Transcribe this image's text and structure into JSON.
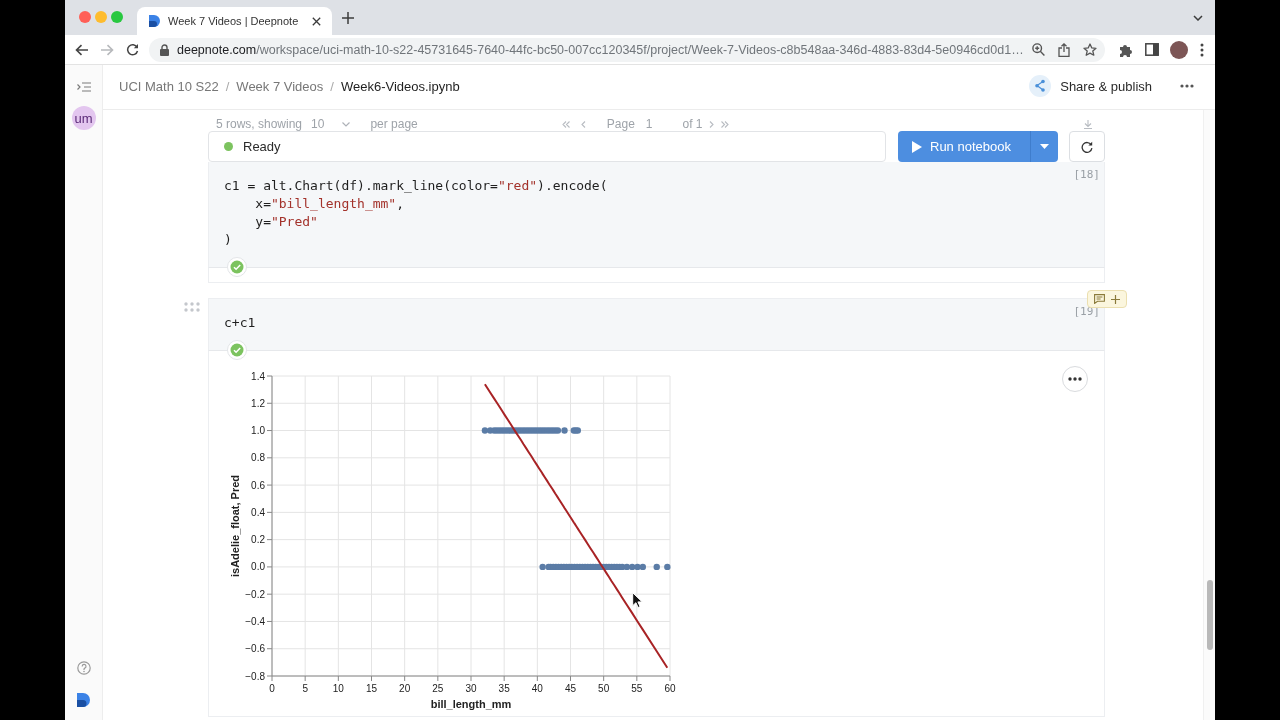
{
  "browser": {
    "tab": {
      "title": "Week 7 Videos | Deepnote"
    },
    "url": {
      "host": "deepnote.com",
      "path": "/workspace/uci-math-10-s22-45731645-7640-44fc-bc50-007cc120345f/project/Week-7-Videos-c8b548aa-346d-4883-83d4-5e0946cd0d1…"
    }
  },
  "sidebar": {
    "avatar": "um"
  },
  "header": {
    "breadcrumbs": [
      {
        "label": "UCI Math 10 S22",
        "current": false
      },
      {
        "label": "Week 7 Videos",
        "current": false
      },
      {
        "label": "Week6-Videos.ipynb",
        "current": true
      }
    ],
    "separator": "/",
    "share_label": "Share & publish"
  },
  "pager": {
    "rows_label": "5 rows, showing",
    "page_size": "10",
    "per_page": "per page",
    "page_label": "Page",
    "page": "1",
    "of_label": "of 1"
  },
  "run_bar": {
    "status": "Ready",
    "run_label": "Run notebook"
  },
  "cells": [
    {
      "count": "[18]",
      "done": true,
      "code": [
        [
          {
            "kind": "plain",
            "text": "c1 = alt.Chart(df).mark_line(color="
          },
          {
            "kind": "string",
            "text": "\"red\""
          },
          {
            "kind": "plain",
            "text": ").encode("
          }
        ],
        [
          {
            "kind": "plain",
            "text": "    x="
          },
          {
            "kind": "string",
            "text": "\"bill_length_mm\""
          },
          {
            "kind": "plain",
            "text": ","
          }
        ],
        [
          {
            "kind": "plain",
            "text": "    y="
          },
          {
            "kind": "string",
            "text": "\"Pred\""
          }
        ],
        [
          {
            "kind": "plain",
            "text": ")"
          }
        ]
      ]
    },
    {
      "count": "[19]",
      "done": true,
      "code": [
        [
          {
            "kind": "plain",
            "text": "c+c1"
          }
        ]
      ],
      "chart_data": {
        "type": "scatter",
        "xlabel": "bill_length_mm",
        "ylabel": "isAdelie_float, Pred",
        "grid": true,
        "xlim": [
          0,
          60
        ],
        "ylim": [
          -0.8,
          1.4
        ],
        "xticks": [
          0,
          5,
          10,
          15,
          20,
          25,
          30,
          35,
          40,
          45,
          50,
          55,
          60
        ],
        "yticks": [
          {
            "value": -0.8,
            "label": "−0.8"
          },
          {
            "value": -0.6,
            "label": "−0.6"
          },
          {
            "value": -0.4,
            "label": "−0.4"
          },
          {
            "value": -0.2,
            "label": "−0.2"
          },
          {
            "value": 0,
            "label": "0.0"
          },
          {
            "value": 0.2,
            "label": "0.2"
          },
          {
            "value": 0.4,
            "label": "0.4"
          },
          {
            "value": 0.6,
            "label": "0.6"
          },
          {
            "value": 0.8,
            "label": "0.8"
          },
          {
            "value": 1,
            "label": "1.0"
          },
          {
            "value": 1.2,
            "label": "1.2"
          },
          {
            "value": 1.4,
            "label": "1.4"
          }
        ],
        "x": [
          32.1,
          32.9,
          33.5,
          33.9,
          34.3,
          34.7,
          35.1,
          35.5,
          35.9,
          36.3,
          36.7,
          37.1,
          37.5,
          37.9,
          38.3,
          38.7,
          39.1,
          39.5,
          39.9,
          40.3,
          40.7,
          40.8,
          41.1,
          41.5,
          41.7,
          41.9,
          42.0,
          42.3,
          42.4,
          42.7,
          42.8,
          43.1,
          43.2,
          43.6,
          44.0,
          44.1,
          44.4,
          44.8,
          45.2,
          45.5,
          45.6,
          45.8,
          46.0,
          46.1,
          46.4,
          46.8,
          47.2,
          47.6,
          48.0,
          48.4,
          48.8,
          49.2,
          49.6,
          50.0,
          50.4,
          50.8,
          51.2,
          51.6,
          52.0,
          52.4,
          52.8,
          53.5,
          54.3,
          55.1,
          55.9,
          58.0,
          59.6
        ],
        "series": [
          {
            "type": "scatter",
            "color": "#5b7ca6",
            "values": [
              1,
              1,
              1,
              1,
              1,
              1,
              1,
              1,
              1,
              1,
              1,
              1,
              1,
              1,
              1,
              1,
              1,
              1,
              1,
              1,
              1,
              0,
              1,
              1,
              0,
              1,
              0,
              1,
              0,
              1,
              0,
              1,
              0,
              0,
              0,
              1,
              0,
              0,
              0,
              1,
              0,
              1,
              0,
              1,
              0,
              0,
              0,
              0,
              0,
              0,
              0,
              0,
              0,
              0,
              0,
              0,
              0,
              0,
              0,
              0,
              0,
              0,
              0,
              0,
              0,
              0,
              0
            ]
          },
          {
            "type": "line",
            "color": "#a82325",
            "values": [
              1.34,
              1.279,
              1.234,
              1.204,
              1.174,
              1.143,
              1.113,
              1.083,
              1.053,
              1.022,
              0.992,
              0.962,
              0.932,
              0.901,
              0.871,
              0.841,
              0.811,
              0.78,
              0.75,
              0.72,
              0.69,
              0.682,
              0.659,
              0.629,
              0.614,
              0.599,
              0.591,
              0.569,
              0.561,
              0.538,
              0.531,
              0.508,
              0.5,
              0.47,
              0.44,
              0.432,
              0.41,
              0.379,
              0.349,
              0.326,
              0.319,
              0.304,
              0.289,
              0.281,
              0.258,
              0.228,
              0.198,
              0.168,
              0.137,
              0.107,
              0.077,
              0.047,
              0.016,
              -0.014,
              -0.044,
              -0.074,
              -0.105,
              -0.135,
              -0.165,
              -0.195,
              -0.226,
              -0.279,
              -0.339,
              -0.4,
              -0.46,
              -0.619,
              -0.74
            ]
          }
        ]
      }
    }
  ]
}
